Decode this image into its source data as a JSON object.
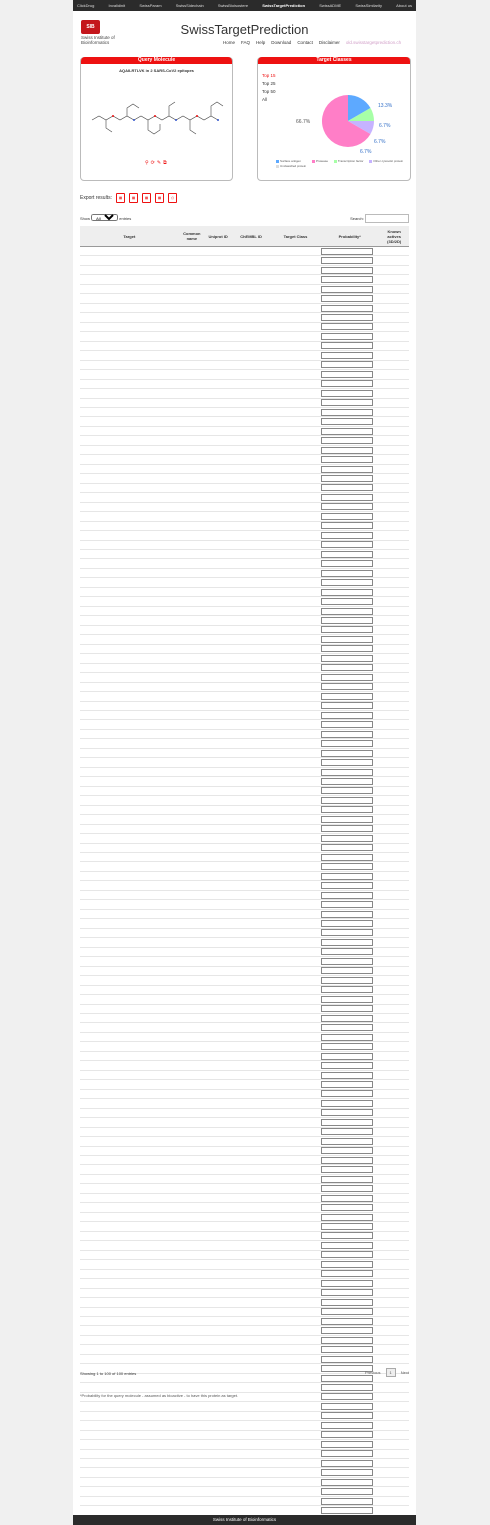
{
  "topbar": {
    "items": [
      "ClickDrug",
      "Invalidinit",
      "SwissParam",
      "SwissSidechain",
      "SwissBioisostere",
      "SwissTargetPrediction",
      "SwissADME",
      "SwissSimilarity",
      "About us"
    ]
  },
  "brand": {
    "logo": "SIB",
    "line1": "Swiss Institute of",
    "line2": "Bioinformatics"
  },
  "app_title": "SwissTargetPrediction",
  "nav": {
    "home": "Home",
    "faq": "FAQ",
    "help": "Help",
    "download": "Download",
    "contact": "Contact",
    "disclaimer": "Disclaimer",
    "external": "old.swisstargetprediction.ch"
  },
  "query_molecule": {
    "header": "Query Molecule",
    "name": "AQAILRTLVK in 2 SARS-CoV2 epitopes"
  },
  "target_classes": {
    "header": "Target Classes",
    "options": [
      "Top 15",
      "Top 25",
      "Top 50",
      "All"
    ],
    "selected": "Top 15",
    "pie_labels": [
      "66.7%",
      "13.3%",
      "6.7%",
      "6.7%",
      "6.7%"
    ],
    "legend": [
      "Surface antigen",
      "Protease",
      "Transcription factor",
      "Other cytosolic protein",
      "Unclassified protein"
    ]
  },
  "export": {
    "label": "Export results:",
    "icons": [
      "csv-icon",
      "xls-icon",
      "pdf-icon",
      "pdf-icon",
      "print-icon"
    ]
  },
  "table_controls": {
    "show": "Show",
    "show_value": "All",
    "entries": "entries",
    "search": "Search:"
  },
  "columns": [
    "Target",
    "Common name",
    "Uniprot ID",
    "ChEMBL ID",
    "Target Class",
    "Probability*",
    "Known actives (3D/2D)"
  ],
  "rows": [],
  "showing": "Showing 1 to 100 of 100 entries",
  "pager": {
    "previous": "Previous",
    "current": "1",
    "next": "Next"
  },
  "footnote": "*Probability for the query molecule - assumed as bioactive - to have this protein as target.",
  "footer": "Swiss Institute of Bioinformatics"
}
